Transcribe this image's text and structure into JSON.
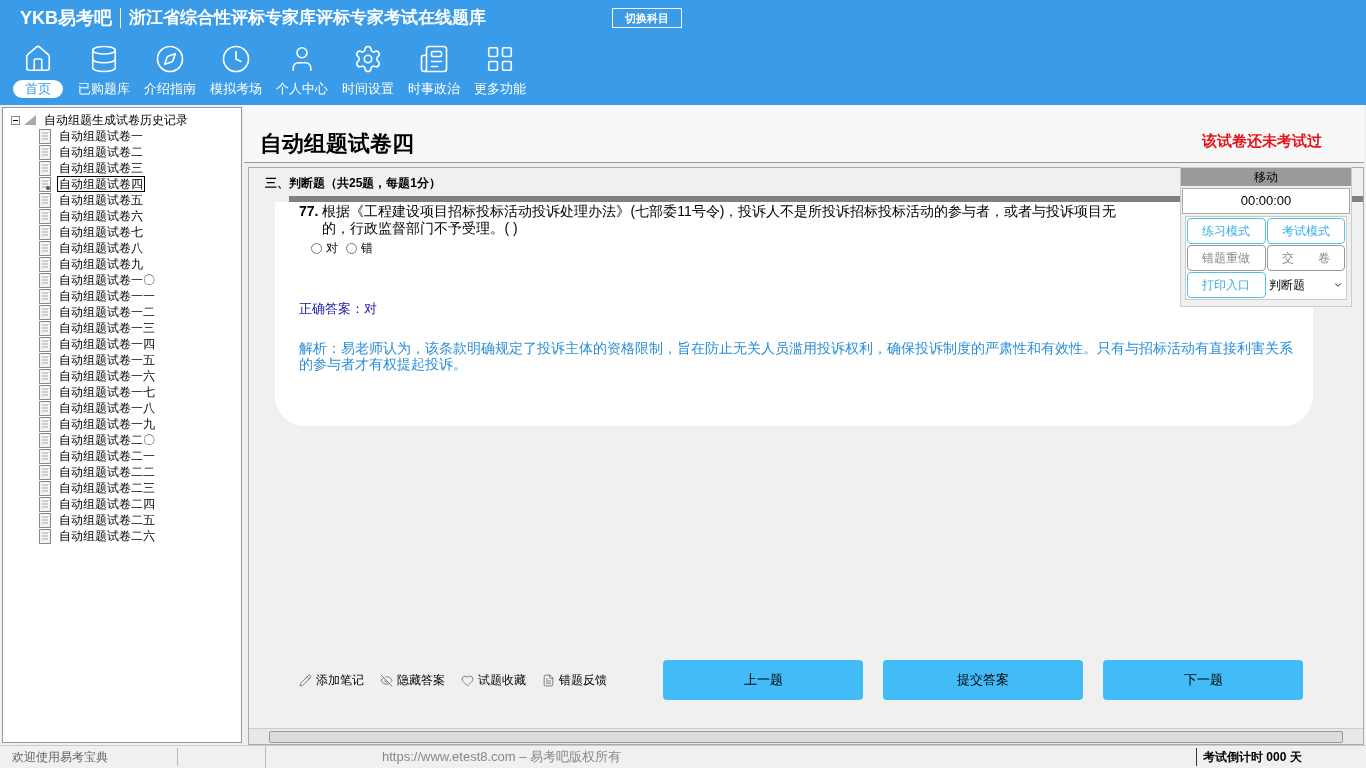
{
  "header": {
    "logo": "YKB易考吧",
    "title": "浙江省综合性评标专家库评标专家考试在线题库",
    "switch_button": "切换科目"
  },
  "nav": [
    {
      "label": "首页",
      "selected": true
    },
    {
      "label": "已购题库",
      "selected": false
    },
    {
      "label": "介绍指南",
      "selected": false
    },
    {
      "label": "模拟考场",
      "selected": false
    },
    {
      "label": "个人中心",
      "selected": false
    },
    {
      "label": "时间设置",
      "selected": false
    },
    {
      "label": "时事政治",
      "selected": false
    },
    {
      "label": "更多功能",
      "selected": false
    }
  ],
  "tree": {
    "label": "自动组题生成试卷历史记录",
    "expanded": true,
    "children": [
      {
        "label": "自动组题试卷一",
        "selected": false
      },
      {
        "label": "自动组题试卷二",
        "selected": false
      },
      {
        "label": "自动组题试卷三",
        "selected": false
      },
      {
        "label": "自动组题试卷四",
        "selected": true
      },
      {
        "label": "自动组题试卷五",
        "selected": false
      },
      {
        "label": "自动组题试卷六",
        "selected": false
      },
      {
        "label": "自动组题试卷七",
        "selected": false
      },
      {
        "label": "自动组题试卷八",
        "selected": false
      },
      {
        "label": "自动组题试卷九",
        "selected": false
      },
      {
        "label": "自动组题试卷一〇",
        "selected": false
      },
      {
        "label": "自动组题试卷一一",
        "selected": false
      },
      {
        "label": "自动组题试卷一二",
        "selected": false
      },
      {
        "label": "自动组题试卷一三",
        "selected": false
      },
      {
        "label": "自动组题试卷一四",
        "selected": false
      },
      {
        "label": "自动组题试卷一五",
        "selected": false
      },
      {
        "label": "自动组题试卷一六",
        "selected": false
      },
      {
        "label": "自动组题试卷一七",
        "selected": false
      },
      {
        "label": "自动组题试卷一八",
        "selected": false
      },
      {
        "label": "自动组题试卷一九",
        "selected": false
      },
      {
        "label": "自动组题试卷二〇",
        "selected": false
      },
      {
        "label": "自动组题试卷二一",
        "selected": false
      },
      {
        "label": "自动组题试卷二二",
        "selected": false
      },
      {
        "label": "自动组题试卷二三",
        "selected": false
      },
      {
        "label": "自动组题试卷二四",
        "selected": false
      },
      {
        "label": "自动组题试卷二五",
        "selected": false
      },
      {
        "label": "自动组题试卷二六",
        "selected": false
      }
    ]
  },
  "paper": {
    "title": "自动组题试卷四",
    "status": "该试卷还未考试过",
    "section": "三、判断题（共25题，每题1分）"
  },
  "question": {
    "number": "77.",
    "lines": [
      "根据《工程建设项目招标投标活动投诉处理办法》(七部委11号令)，投诉人不是所投诉招标投标活动的参与者，或者与投诉项目无",
      "的，行政监督部门不予受理。( )"
    ],
    "options": [
      {
        "label": "对",
        "selected": false
      },
      {
        "label": "错",
        "selected": false
      }
    ],
    "answer": "正确答案：对",
    "analysis": "解析：易老师认为，该条款明确规定了投诉主体的资格限制，旨在防止无关人员滥用投诉权利，确保投诉制度的严肃性和有效性。只有与招标活动有直接利害关系的参与者才有权提起投诉。"
  },
  "tools": [
    "添加笔记",
    "隐藏答案",
    "试题收藏",
    "错题反馈"
  ],
  "nav_buttons": [
    "上一题",
    "提交答案",
    "下一题"
  ],
  "panel": {
    "title": "移动",
    "timer": "00:00:00",
    "buttons": [
      {
        "label": "练习模式",
        "enabled": true
      },
      {
        "label": "考试模式",
        "enabled": true
      },
      {
        "label": "错题重做",
        "enabled": false
      },
      {
        "label": "交　　卷",
        "enabled": false
      },
      {
        "label": "打印入口",
        "enabled": true
      }
    ],
    "type_select": "判断题"
  },
  "status_bar": {
    "welcome": "欢迎使用易考宝典",
    "copyright": "https://www.etest8.com – 易考吧版权所有",
    "countdown": "考试倒计时 000 天"
  }
}
